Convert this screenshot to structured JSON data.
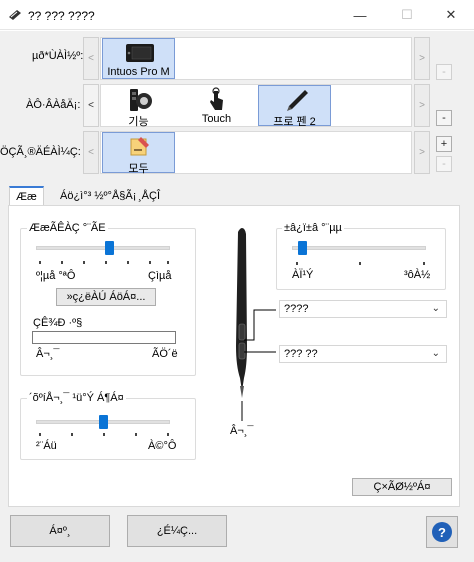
{
  "window": {
    "title": "?? ??? ????",
    "minimize_glyph": "—",
    "maximize_glyph": "☐",
    "close_glyph": "✕"
  },
  "devices": {
    "label": "µð*ÙÀÌ½º:",
    "items": [
      {
        "label": "Intuos Pro M",
        "selected": true
      }
    ]
  },
  "tools": {
    "label": "ÀÔ·ÂÀåÄ¡:",
    "items": [
      {
        "label": "기능",
        "selected": false
      },
      {
        "label": "Touch",
        "selected": false
      },
      {
        "label": "프로 펜 2",
        "selected": true
      }
    ]
  },
  "applications": {
    "label": "ÖÇÃ¸®ÄÉÀÌ¼Ç:",
    "items": [
      {
        "label": "모두",
        "selected": true
      }
    ]
  },
  "nav": {
    "prev_glyph": "<",
    "next_glyph": ">",
    "remove_glyph": "-",
    "add_glyph": "+"
  },
  "tabs": [
    {
      "label": "Ææ",
      "active": true
    },
    {
      "label": "Áö¿ì°³ ½º°Å§Ã¡",
      "active": false
    },
    {
      "label": "¸ÅÇÎ",
      "active": false
    }
  ],
  "pen_panel": {
    "pressure_group_title": "ÆæÃÊÀÇ °¨ÃE",
    "pressure_left": "º¦µå °ªÔ",
    "pressure_right": "Çìµå",
    "pressure_value_percent": 55,
    "customize_button": "»ç¿ëÀÚ ÁöÁ¤...",
    "test_label": "ÇÊ¾Ð ·º§",
    "test_left": "Â¬¸¯",
    "test_right": "ÃÖ´ë",
    "double_click_group_title": "´õºíÅ¬¸¯ ¹ü°Ý Á¶Á¤",
    "double_click_left": "²¨Áü",
    "double_click_right": "À©°Ô",
    "double_click_value_percent": 50,
    "tilt_group_title": "±â¿ï±â °¨µµ",
    "tilt_left": "ÀÏ¹Ý",
    "tilt_right": "³ôÀ½",
    "tilt_value_percent": 5,
    "upper_button_value": "????",
    "lower_button_value": "??? ??",
    "tip_label": "Â¬¸¯",
    "default_button": "Ç×ÃØ½ºÁ¤"
  },
  "footer": {
    "left_button": "Á¤º¸",
    "middle_button": "¿É¼Ç...",
    "help_glyph": "?"
  },
  "colors": {
    "accent": "#0a74d6",
    "selection": "#cfe0f8",
    "selection_border": "#7a9bd6"
  }
}
